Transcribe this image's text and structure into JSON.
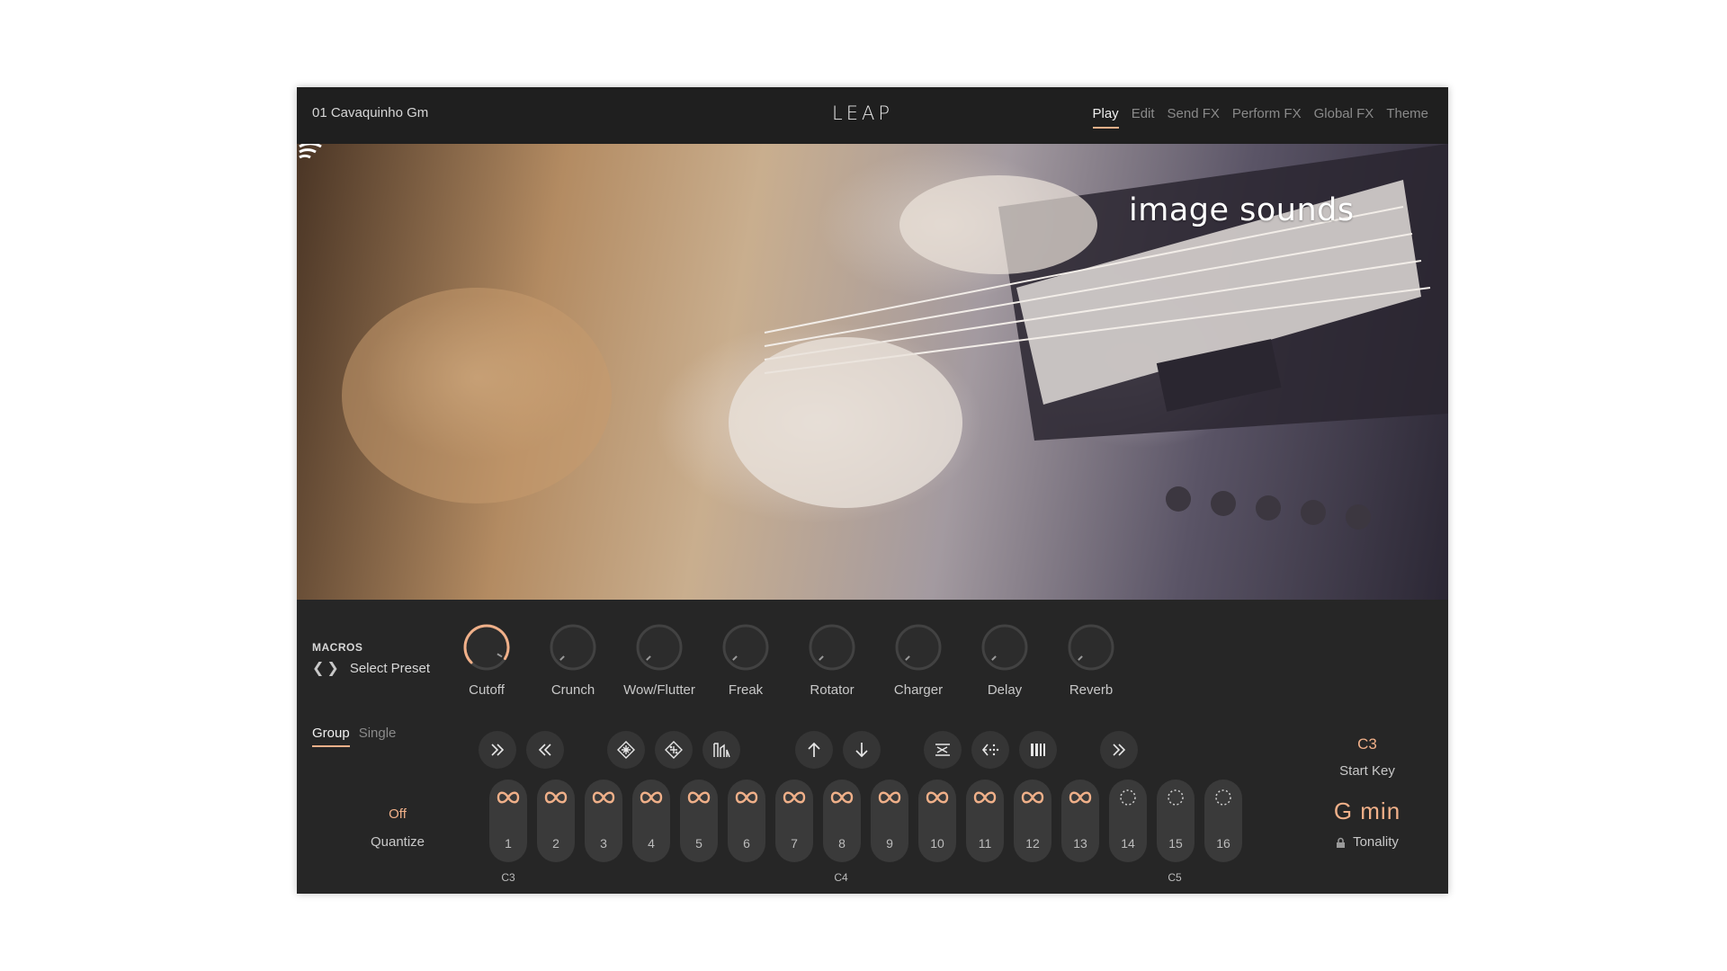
{
  "header": {
    "preset_name": "01 Cavaquinho Gm",
    "logo": "LEAP",
    "nav": [
      "Play",
      "Edit",
      "Send FX",
      "Perform FX",
      "Global FX",
      "Theme"
    ],
    "active_nav": "Play"
  },
  "hero": {
    "brand": "image sounds",
    "brand_icon": "signal-waves-icon"
  },
  "macros": {
    "title": "MACROS",
    "select_label": "Select Preset",
    "knobs": [
      {
        "label": "Cutoff",
        "value": 0.95
      },
      {
        "label": "Crunch",
        "value": 0.0
      },
      {
        "label": "Wow/Flutter",
        "value": 0.0
      },
      {
        "label": "Freak",
        "value": 0.0
      },
      {
        "label": "Rotator",
        "value": 0.0
      },
      {
        "label": "Charger",
        "value": 0.0
      },
      {
        "label": "Delay",
        "value": 0.0
      },
      {
        "label": "Reverb",
        "value": 0.0
      }
    ]
  },
  "mode_tabs": [
    "Group",
    "Single"
  ],
  "active_mode": "Group",
  "quantize": {
    "value": "Off",
    "label": "Quantize"
  },
  "actions": [
    {
      "name": "forward-icon"
    },
    {
      "name": "rewind-icon"
    },
    {
      "name": "shuffle-grid-icon"
    },
    {
      "name": "randomize-grid-icon"
    },
    {
      "name": "waveform-icon"
    },
    {
      "name": "up-arrow-icon"
    },
    {
      "name": "down-arrow-icon"
    },
    {
      "name": "swap-icon"
    },
    {
      "name": "reverse-icon"
    },
    {
      "name": "slices-icon"
    },
    {
      "name": "next-icon"
    }
  ],
  "pads": [
    {
      "num": "1",
      "mode": "loop"
    },
    {
      "num": "2",
      "mode": "loop"
    },
    {
      "num": "3",
      "mode": "loop"
    },
    {
      "num": "4",
      "mode": "loop"
    },
    {
      "num": "5",
      "mode": "loop"
    },
    {
      "num": "6",
      "mode": "loop"
    },
    {
      "num": "7",
      "mode": "loop"
    },
    {
      "num": "8",
      "mode": "loop"
    },
    {
      "num": "9",
      "mode": "loop"
    },
    {
      "num": "10",
      "mode": "loop"
    },
    {
      "num": "11",
      "mode": "loop"
    },
    {
      "num": "12",
      "mode": "loop"
    },
    {
      "num": "13",
      "mode": "loop"
    },
    {
      "num": "14",
      "mode": "oneshot"
    },
    {
      "num": "15",
      "mode": "oneshot"
    },
    {
      "num": "16",
      "mode": "oneshot"
    }
  ],
  "note_labels": [
    "C3",
    "C4",
    "C5"
  ],
  "start_key": {
    "value": "C3",
    "label": "Start Key"
  },
  "tonality": {
    "value": "G  min",
    "label": "Tonality"
  },
  "colors": {
    "accent": "#f0b089",
    "background": "#262626",
    "pad": "#3a3a3a"
  }
}
